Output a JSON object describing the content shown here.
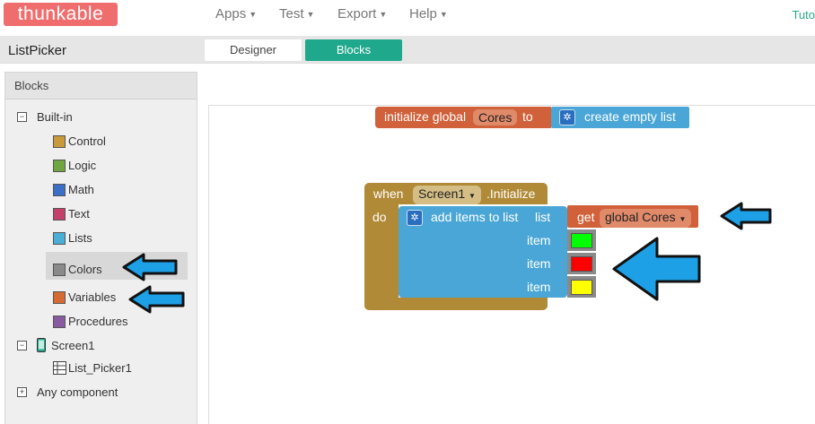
{
  "header": {
    "logo": "thunkable",
    "menus": [
      "Apps",
      "Test",
      "Export",
      "Help"
    ],
    "tutorial_link": "Tuto"
  },
  "subbar": {
    "project_name": "ListPicker",
    "tabs": [
      "Designer",
      "Blocks"
    ],
    "active_tab": "Blocks"
  },
  "sidebar": {
    "title": "Blocks",
    "builtin_label": "Built-in",
    "categories": [
      {
        "label": "Control",
        "color": "#c99a3a"
      },
      {
        "label": "Logic",
        "color": "#6fa640"
      },
      {
        "label": "Math",
        "color": "#3a6ec7"
      },
      {
        "label": "Text",
        "color": "#c2406a"
      },
      {
        "label": "Lists",
        "color": "#4aaed6"
      },
      {
        "label": "Colors",
        "color": "#8a8a8a"
      },
      {
        "label": "Variables",
        "color": "#d66a33"
      },
      {
        "label": "Procedures",
        "color": "#8a5aa0"
      }
    ],
    "screen_label": "Screen1",
    "component_label": "List_Picker1",
    "any_component_label": "Any component"
  },
  "blocks": {
    "init": {
      "prefix": "initialize global",
      "var_name": "Cores",
      "to": "to",
      "create": "create empty list"
    },
    "event": {
      "when": "when",
      "component": "Screen1",
      "event_name": ".Initialize",
      "do": "do",
      "add_items": "add items to list",
      "list_label": "list",
      "get": "get",
      "get_var": "global Cores",
      "item_label": "item",
      "items": [
        {
          "label": "item",
          "color": "#00ff00"
        },
        {
          "label": "item",
          "color": "#ff0000"
        },
        {
          "label": "item",
          "color": "#ffff00"
        }
      ]
    }
  },
  "colors": {
    "accent": "#1fa88c",
    "arrow": "#1ea0e6"
  }
}
